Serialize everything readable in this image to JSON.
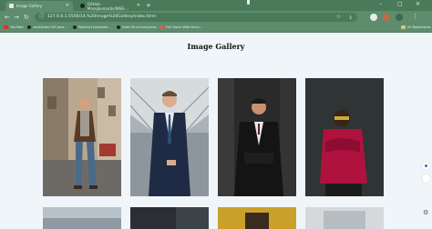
{
  "browser": {
    "tabs": [
      {
        "title": "Image Gallery",
        "active": true,
        "favicon_color": "#e7e7e7"
      },
      {
        "title": "GitHub - Manojkumarbs/WEB-...",
        "active": false,
        "favicon_color": "#222222"
      }
    ],
    "new_tab_label": "+",
    "window_controls": [
      "–",
      "□",
      "✕"
    ],
    "address": "127.0.0.1:5500/14.%20Image%20Gallery/index.html",
    "bookmarks": [
      {
        "label": "YouTube",
        "icon_color": "#e52d27"
      },
      {
        "label": "vedCoder/100 Java...",
        "icon_color": "#222222"
      },
      {
        "label": "Pavitra/1Leetcode...",
        "icon_color": "#222222"
      },
      {
        "label": "Data Structures/Java...",
        "icon_color": "#222222"
      },
      {
        "label": "Full Stack Web Deve...",
        "icon_color": "#ff4b4b"
      }
    ],
    "all_bookmarks_label": "All Bookmarks",
    "accent_color": "#5d8d6d"
  },
  "page": {
    "title": "Image Gallery",
    "background": "#f0f5f9",
    "gallery": [
      {
        "alt": "Man in brown jacket on street"
      },
      {
        "alt": "Man in navy suit in glass tunnel"
      },
      {
        "alt": "Man in black suit dark background"
      },
      {
        "alt": "Man in red sweater with sunglasses"
      },
      {
        "alt": "Gallery image 5"
      },
      {
        "alt": "Gallery image 6"
      },
      {
        "alt": "Gallery image 7"
      },
      {
        "alt": "Gallery image 8"
      }
    ]
  }
}
